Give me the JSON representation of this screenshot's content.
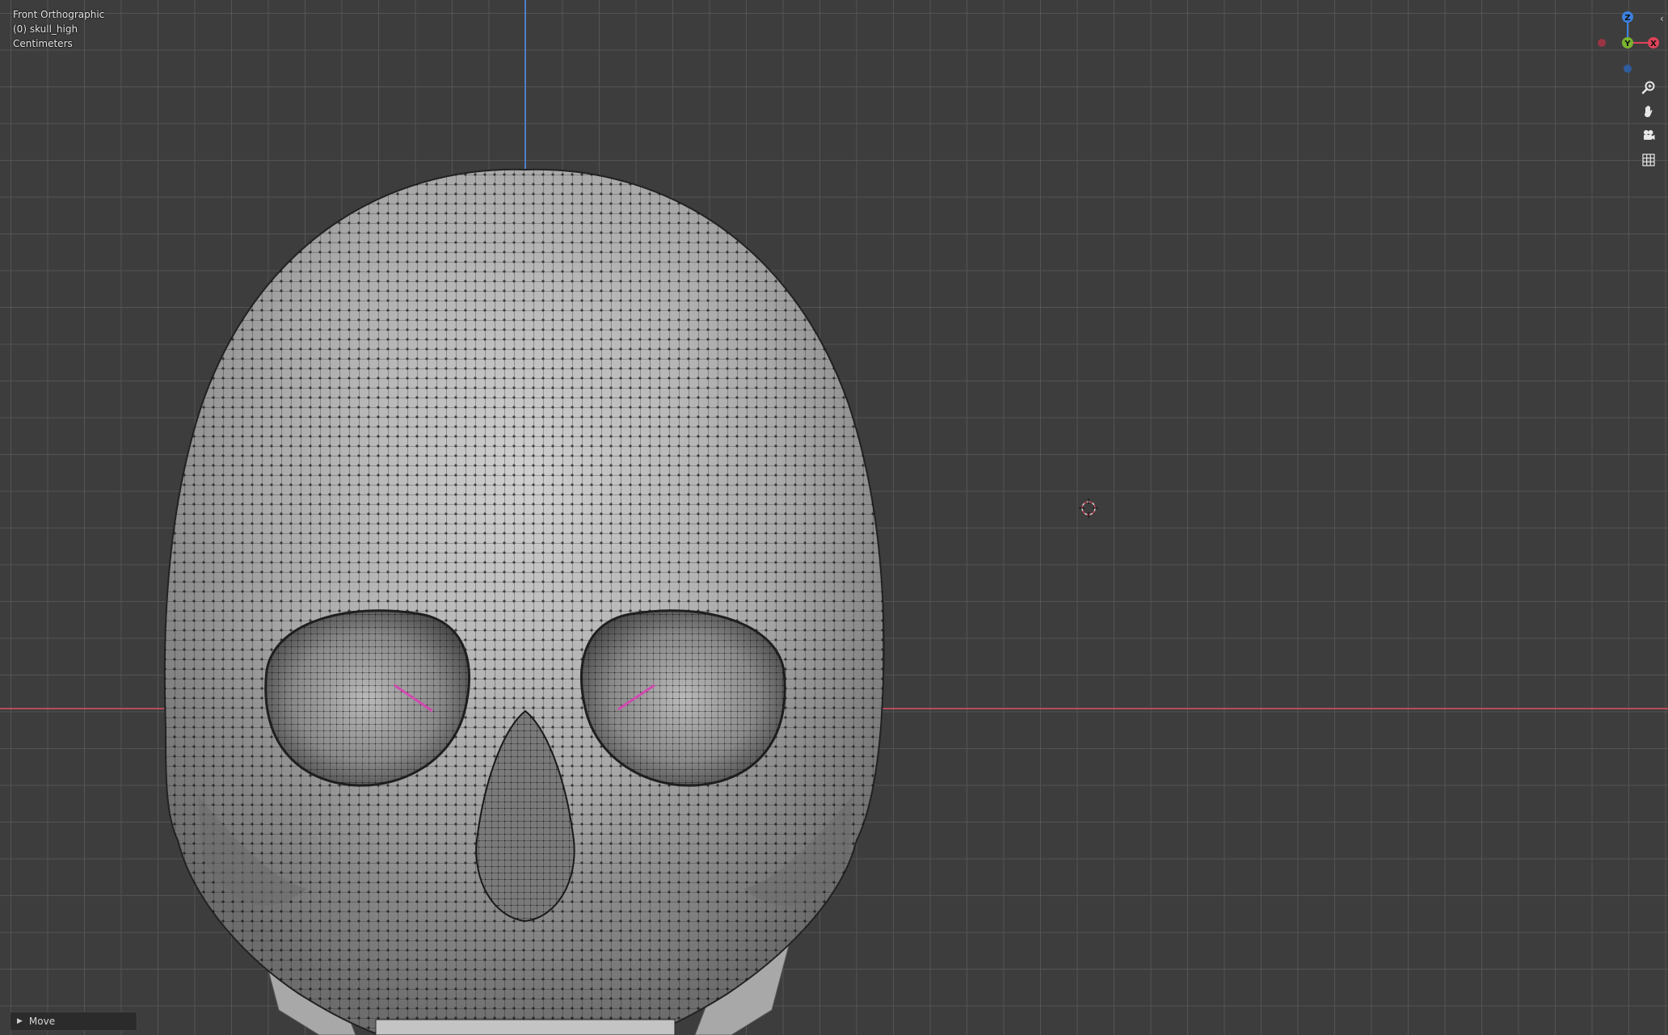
{
  "viewport": {
    "view_name": "Front Orthographic",
    "object_name": "(0) skull_high",
    "units": "Centimeters"
  },
  "gizmo": {
    "z_label": "Z",
    "y_label": "Y",
    "x_label": "X",
    "colors": {
      "x": "#e0435a",
      "y": "#7ab32f",
      "z": "#3d7fe0"
    }
  },
  "nav_buttons": {
    "zoom_icon": "magnifier-icon",
    "pan_icon": "hand-icon",
    "camera_icon": "camera-icon",
    "ortho_icon": "grid-icon"
  },
  "last_operation": {
    "label": "Move"
  },
  "colors": {
    "background": "#3d3d3d",
    "grid": "#565656",
    "axis_x": "#b44d5c",
    "axis_z": "#4e7fc9",
    "mesh_fill": "#aaaaaa",
    "wire": "#111111"
  }
}
